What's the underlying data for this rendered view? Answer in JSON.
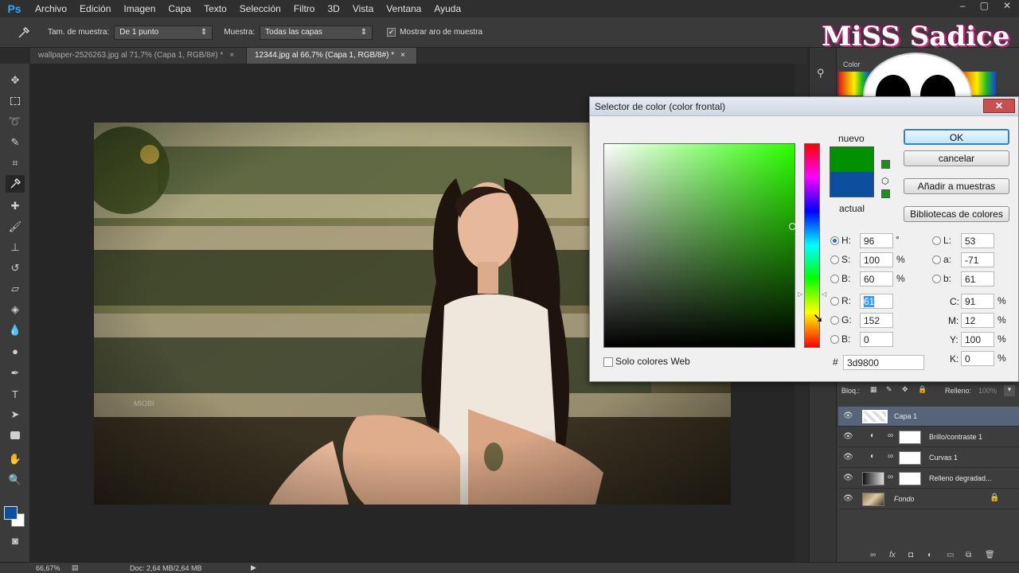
{
  "app": {
    "logo": "Ps"
  },
  "menu": [
    "Archivo",
    "Edición",
    "Imagen",
    "Capa",
    "Texto",
    "Selección",
    "Filtro",
    "3D",
    "Vista",
    "Ventana",
    "Ayuda"
  ],
  "window_controls": [
    "–",
    "▢",
    "✕"
  ],
  "options_bar": {
    "sample_size_label": "Tam. de muestra:",
    "sample_size_value": "De 1 punto",
    "sample_label": "Muestra:",
    "sample_value": "Todas las capas",
    "show_ring_label": "Mostrar aro de muestra",
    "show_ring_checked": true
  },
  "tabs": [
    {
      "title": "wallpaper-2526263.jpg al 71,7% (Capa 1, RGB/8#) *",
      "close": "×",
      "active": false
    },
    {
      "title": "12344.jpg al 66,7% (Capa 1, RGB/8#) *",
      "close": "×",
      "active": true
    }
  ],
  "photo": {
    "caption": "MIOBI"
  },
  "status": {
    "zoom": "66,67%",
    "doc": "Doc: 2,64 MB/2,64 MB"
  },
  "color_panel": {
    "tab_label": "Color"
  },
  "layers_panel": {
    "lock_label": "Bloq.:",
    "fill_label": "Relleno:",
    "fill_value": "100%",
    "layers": [
      {
        "name": "Capa 1",
        "active": true,
        "type": "pixel"
      },
      {
        "name": "Brillo/contraste 1",
        "active": false,
        "type": "adjustment"
      },
      {
        "name": "Curvas 1",
        "active": false,
        "type": "adjustment"
      },
      {
        "name": "Relleno degradad...",
        "active": false,
        "type": "gradient"
      },
      {
        "name": "Fondo",
        "active": false,
        "type": "background",
        "locked": true
      }
    ]
  },
  "color_picker": {
    "title": "Selector de color (color frontal)",
    "close": "✕",
    "new_label": "nuevo",
    "current_label": "actual",
    "new_color": "#009000",
    "current_color": "#0c4f9e",
    "buttons": {
      "ok": "OK",
      "cancel": "cancelar",
      "add": "Añadir a muestras",
      "libraries": "Bibliotecas de colores"
    },
    "web_only_label": "Solo colores Web",
    "hsb": {
      "H": "96",
      "H_unit": "°",
      "S": "100",
      "S_unit": "%",
      "B": "60",
      "B_unit": "%"
    },
    "rgb": {
      "R": "61",
      "G": "152",
      "B": "0"
    },
    "lab": {
      "L": "53",
      "a": "-71",
      "b": "61"
    },
    "cmyk": {
      "C": "91",
      "M": "12",
      "Y": "100",
      "K": "0",
      "unit": "%"
    },
    "labels": {
      "H": "H:",
      "S": "S:",
      "Bb": "B:",
      "R": "R:",
      "G": "G:",
      "B": "B:",
      "L": "L:",
      "a": "a:",
      "b": "b:",
      "C": "C:",
      "M": "M:",
      "Y": "Y:",
      "K": "K:",
      "hash": "#"
    },
    "hex": "3d9800",
    "selected_mode": "H"
  },
  "watermark": {
    "text": "MiSS Sadice"
  }
}
